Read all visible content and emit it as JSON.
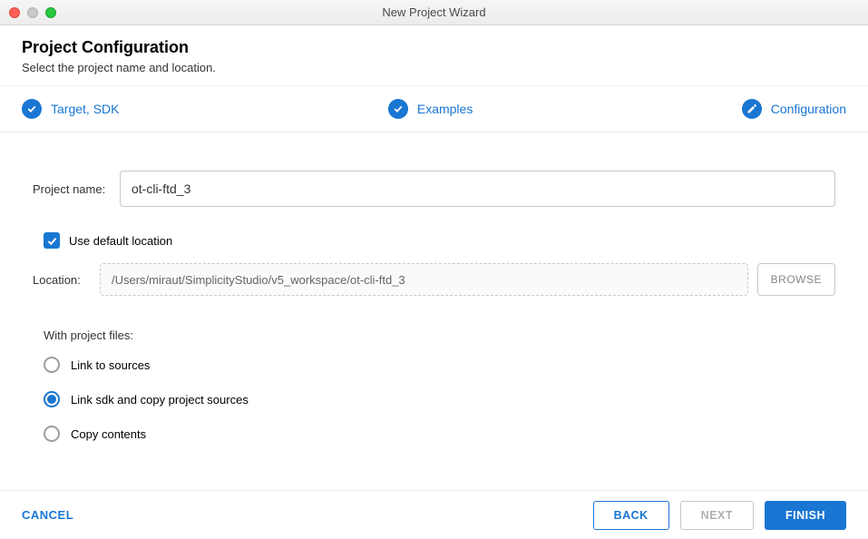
{
  "window": {
    "title": "New Project Wizard"
  },
  "header": {
    "title": "Project Configuration",
    "subtitle": "Select the project name and location."
  },
  "steps": {
    "target": "Target, SDK",
    "examples": "Examples",
    "configuration": "Configuration"
  },
  "form": {
    "project_name_label": "Project name:",
    "project_name_value": "ot-cli-ftd_3",
    "use_default_location_label": "Use default location",
    "location_label": "Location:",
    "location_value": "/Users/miraut/SimplicityStudio/v5_workspace/ot-cli-ftd_3",
    "browse_label": "BROWSE",
    "with_project_files_label": "With project files:",
    "radio_options": {
      "link_sources": "Link to sources",
      "link_sdk_copy": "Link sdk and copy project sources",
      "copy_contents": "Copy contents"
    }
  },
  "footer": {
    "cancel": "CANCEL",
    "back": "BACK",
    "next": "NEXT",
    "finish": "FINISH"
  }
}
